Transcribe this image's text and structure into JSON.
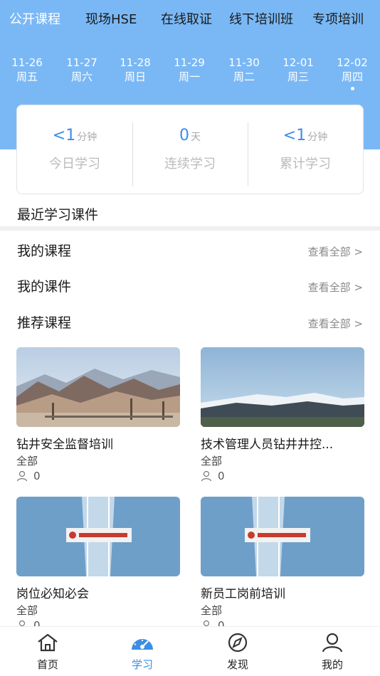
{
  "top_tabs": [
    {
      "label": "公开课程",
      "active": true
    },
    {
      "label": "现场HSE",
      "active": false
    },
    {
      "label": "在线取证",
      "active": false
    },
    {
      "label": "线下培训班",
      "active": false
    },
    {
      "label": "专项培训",
      "active": false
    }
  ],
  "dates": [
    {
      "date": "11-26",
      "weekday": "周五"
    },
    {
      "date": "11-27",
      "weekday": "周六"
    },
    {
      "date": "11-28",
      "weekday": "周日"
    },
    {
      "date": "11-29",
      "weekday": "周一"
    },
    {
      "date": "11-30",
      "weekday": "周二"
    },
    {
      "date": "12-01",
      "weekday": "周三"
    },
    {
      "date": "12-02",
      "weekday": "周四",
      "selected": true
    }
  ],
  "stats": [
    {
      "value": "<1",
      "unit": "分钟",
      "label": "今日学习"
    },
    {
      "value": "0",
      "unit": "天",
      "label": "连续学习"
    },
    {
      "value": "<1",
      "unit": "分钟",
      "label": "累计学习"
    }
  ],
  "recent_title": "最近学习课件",
  "sections": [
    {
      "name": "我的课程",
      "more": "查看全部 >"
    },
    {
      "name": "我的课件",
      "more": "查看全部 >"
    },
    {
      "name": "推荐课程",
      "more": "查看全部 >"
    }
  ],
  "courses": [
    {
      "title": "钻井安全监督培训",
      "category": "全部",
      "count": "0",
      "image": "desert-mountains-rigs"
    },
    {
      "title": "技术管理人员钻井井控...",
      "category": "全部",
      "count": "0",
      "image": "snow-mountains"
    },
    {
      "title": "岗位必知必会",
      "category": "全部",
      "count": "0",
      "image": "drilling-tower-sign"
    },
    {
      "title": "新员工岗前培训",
      "category": "全部",
      "count": "0",
      "image": "drilling-tower-sign"
    }
  ],
  "bottom_nav": [
    {
      "label": "首页",
      "icon": "home-icon",
      "active": false
    },
    {
      "label": "学习",
      "icon": "dashboard-icon",
      "active": true
    },
    {
      "label": "发现",
      "icon": "compass-icon",
      "active": false
    },
    {
      "label": "我的",
      "icon": "user-icon",
      "active": false
    }
  ],
  "colors": {
    "header_bg": "#7ab8f5",
    "accent": "#3a8ee6"
  }
}
